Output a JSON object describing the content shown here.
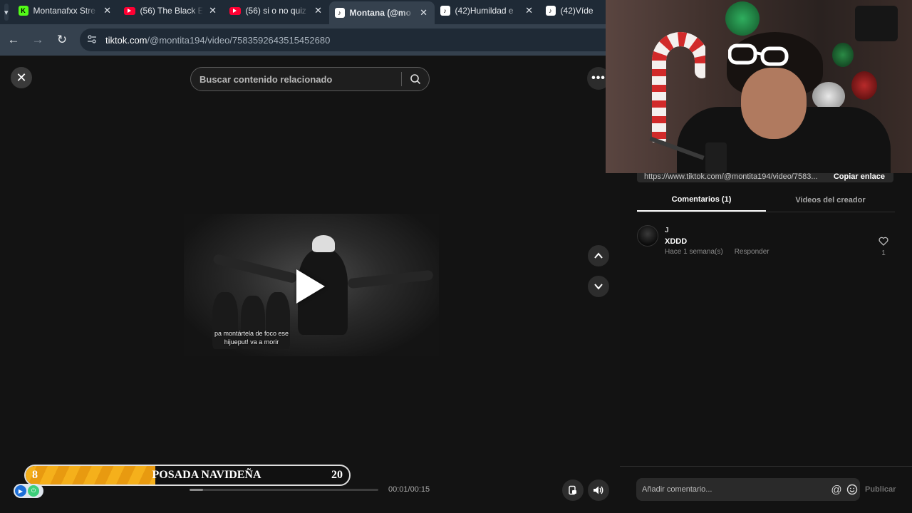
{
  "browser": {
    "tabs": [
      {
        "title": "Montanafxx Stre",
        "favicon": "kick-icon",
        "favicon_color": "#53fc18",
        "active": false
      },
      {
        "title": "(56) The Black Ey",
        "favicon": "youtube-icon",
        "favicon_color": "#ff0033",
        "active": false
      },
      {
        "title": "(56) si o no quiz",
        "favicon": "youtube-icon",
        "favicon_color": "#ff0033",
        "active": false
      },
      {
        "title": "Montana (@mo",
        "favicon": "tiktok-icon",
        "favicon_color": "#000000",
        "active": true
      },
      {
        "title": "(42)Humildad e",
        "favicon": "tiktok-icon",
        "favicon_color": "#000000",
        "active": false
      },
      {
        "title": "(42)Víde",
        "favicon": "tiktok-icon",
        "favicon_color": "#000000",
        "active": false
      }
    ],
    "url_host": "tiktok.com",
    "url_path": "/@montita194/video/7583592643515452680"
  },
  "viewer": {
    "search_placeholder": "Buscar contenido relacionado",
    "subtitle_line1": "pa montártela de foco ese",
    "subtitle_line2": "hijueput! va a morir",
    "time": "00:01/00:15",
    "progress": 0.07
  },
  "panel": {
    "link_url": "https://www.tiktok.com/@montita194/video/7583...",
    "copy_link": "Copiar enlace",
    "tab_comments": "Comentarios (1)",
    "tab_creator": "Videos del creador",
    "comment": {
      "user": "J",
      "text": "XDDD",
      "time": "Hace 1 semana(s)",
      "reply": "Responder",
      "likes": "1"
    },
    "input_placeholder": "Añadir comentario...",
    "publish": "Publicar"
  },
  "overlay": {
    "left_value": "8",
    "title": "POSADA NAVIDEÑA",
    "right_value": "20",
    "progress_fraction": 0.4
  },
  "colors": {
    "accent_gold": "#f5b01b",
    "tiktok_bg": "#121212"
  }
}
